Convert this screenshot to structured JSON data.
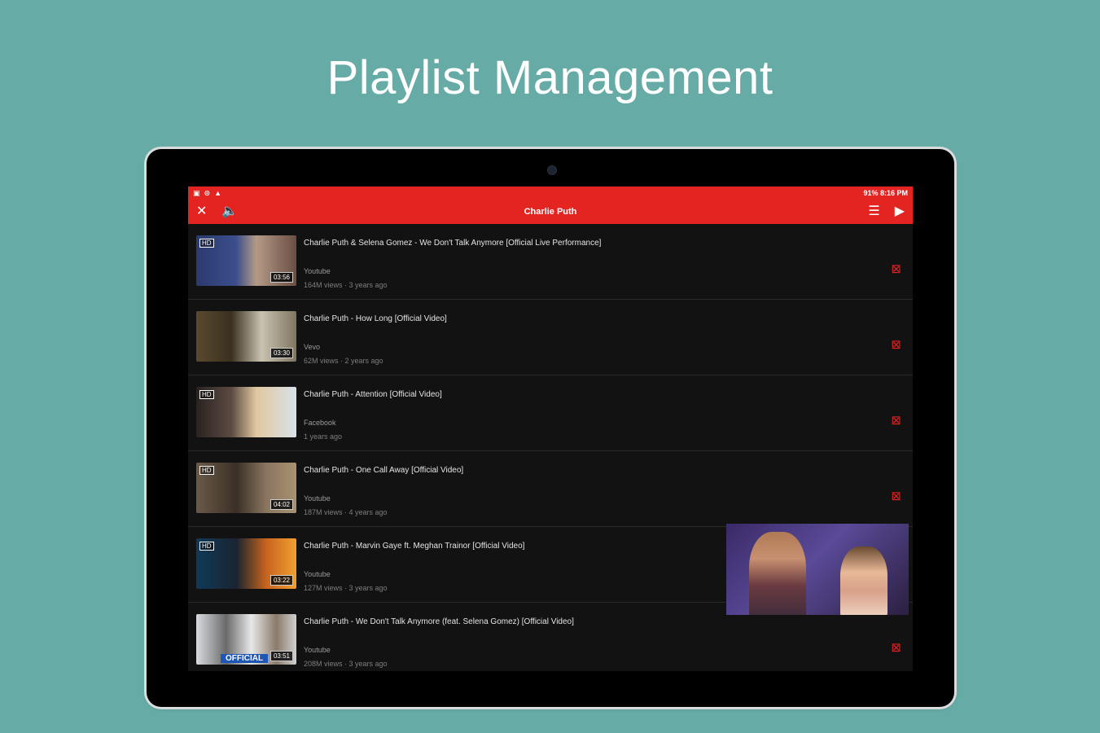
{
  "headline": "Playlist Management",
  "status_bar": {
    "right": "91% 8:16 PM"
  },
  "toolbar": {
    "title": "Charlie Puth"
  },
  "colors": {
    "accent": "#e32421",
    "background": "#66aba6",
    "list_bg": "#121212"
  },
  "icons": {
    "close": "close-icon",
    "volume": "volume-icon",
    "queue": "playlist-add-icon",
    "play": "play-icon",
    "remove": "remove-from-playlist-icon"
  },
  "videos": [
    {
      "title": "Charlie Puth & Selena Gomez - We Don't Talk Anymore [Official Live Performance]",
      "source": "Youtube",
      "meta": "164M views · 3 years ago",
      "duration": "03:56",
      "badge": "HD"
    },
    {
      "title": "Charlie Puth - How Long [Official Video]",
      "source": "Vevo",
      "meta": "62M views · 2 years ago",
      "duration": "03:30",
      "badge": ""
    },
    {
      "title": "Charlie Puth - Attention [Official Video]",
      "source": "Facebook",
      "meta": "1 years ago",
      "duration": "",
      "badge": "HD"
    },
    {
      "title": "Charlie Puth - One Call Away [Official Video]",
      "source": "Youtube",
      "meta": "187M views · 4 years ago",
      "duration": "04:02",
      "badge": "HD"
    },
    {
      "title": "Charlie Puth - Marvin Gaye ft. Meghan Trainor [Official Video]",
      "source": "Youtube",
      "meta": "127M views · 3 years ago",
      "duration": "03:22",
      "badge": "HD"
    },
    {
      "title": "Charlie Puth - We Don't Talk Anymore (feat. Selena Gomez) [Official Video]",
      "source": "Youtube",
      "meta": "208M views · 3 years ago",
      "duration": "03:51",
      "badge": "",
      "official": "OFFICIAL"
    }
  ]
}
